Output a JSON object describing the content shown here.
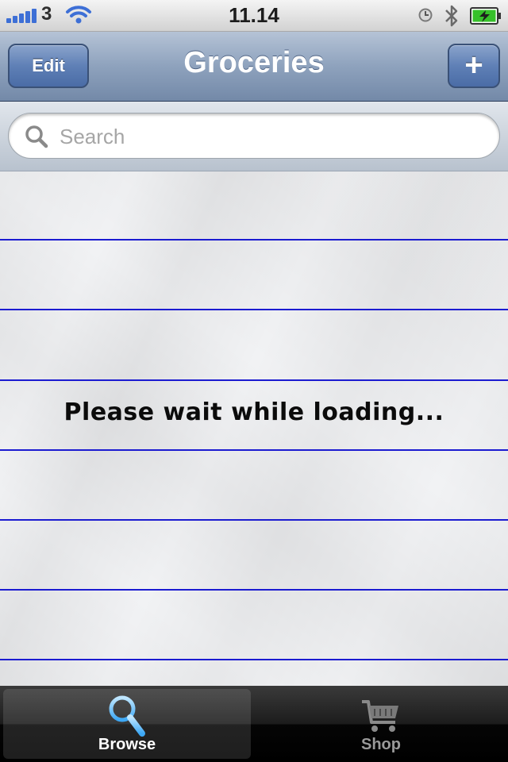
{
  "status_bar": {
    "carrier": "3",
    "time": "11.14",
    "signal_bars": 5,
    "icons": [
      "signal-icon",
      "wifi-icon",
      "alarm-icon",
      "bluetooth-icon",
      "battery-charging-icon"
    ]
  },
  "nav": {
    "edit_label": "Edit",
    "title": "Groceries",
    "add_label": "+"
  },
  "search": {
    "placeholder": "Search",
    "value": ""
  },
  "content": {
    "loading_text": "Please wait while loading..."
  },
  "tabs": [
    {
      "label": "Browse",
      "icon": "magnifier-icon",
      "selected": true
    },
    {
      "label": "Shop",
      "icon": "shopping-cart-icon",
      "selected": false
    }
  ],
  "colors": {
    "rule_line": "#1b1bd1",
    "nav_bar": "#8ea2bd",
    "accent_blue": "#3da8f5"
  }
}
